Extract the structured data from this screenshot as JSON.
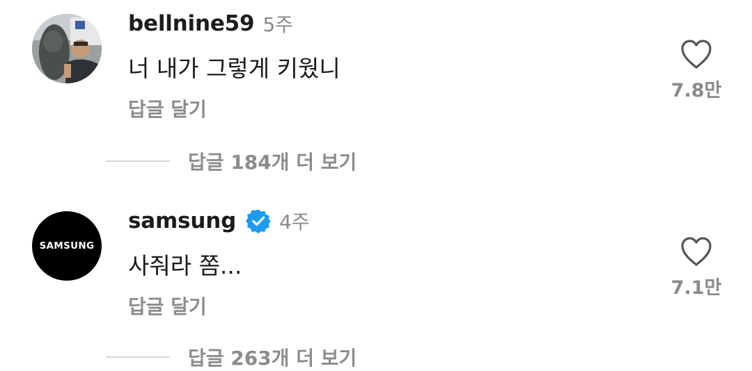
{
  "comments": [
    {
      "username": "bellnine59",
      "time": "5주",
      "text": "너 내가 그렇게 키웠니",
      "reply_label": "답글 달기",
      "likes": "7.8만",
      "verified": false,
      "more_replies": "답글 184개 더 보기"
    },
    {
      "username": "samsung",
      "time": "4주",
      "text": "사줘라 쫌...",
      "reply_label": "답글 달기",
      "likes": "7.1만",
      "verified": true,
      "avatar_text": "SAMSUNG",
      "more_replies": "답글 263개 더 보기"
    }
  ],
  "icons": {
    "like": "heart-outline-icon",
    "verified": "verified-badge-icon"
  },
  "colors": {
    "verified": "#1d9bf0",
    "muted_text": "#8a8a8a"
  }
}
